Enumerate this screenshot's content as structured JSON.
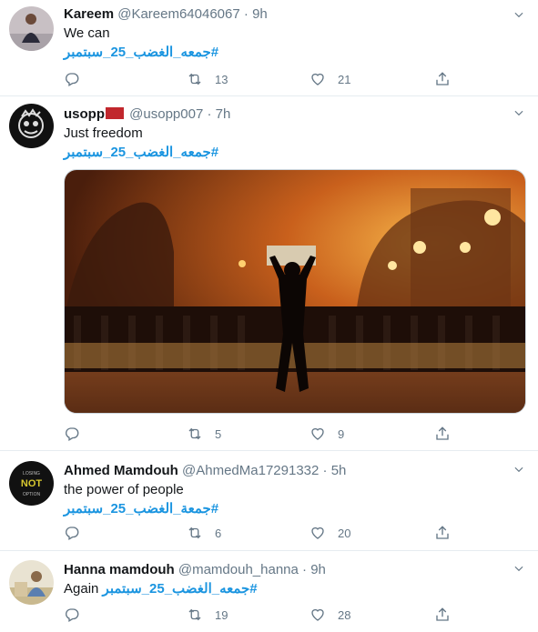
{
  "tweets": [
    {
      "name": "Kareem",
      "handle": "@Kareem64046067",
      "dot": "·",
      "time": "9h",
      "text": "We can",
      "hashtag": "#جمعه_الغضب_25_سبتمبر",
      "retweets": "13",
      "likes": "21"
    },
    {
      "name": "usopp",
      "handle": "@usopp007",
      "dot": "·",
      "time": "7h",
      "text": "Just freedom",
      "hashtag": "#جمعه_الغضب_25_سبتمبر",
      "retweets": "5",
      "likes": "9"
    },
    {
      "name": "Ahmed Mamdouh",
      "handle": "@AhmedMa17291332",
      "dot": "·",
      "time": "5h",
      "text": "the power of people",
      "hashtag": "#جمعة_الغضب_25_سبتمبر",
      "retweets": "6",
      "likes": "20",
      "avatar_text": [
        "LOSING",
        "NOT",
        "OPTION"
      ]
    },
    {
      "name": "Hanna mamdouh",
      "handle": "@mamdouh_hanna",
      "dot": "·",
      "time": "9h",
      "text": "Again",
      "hashtag": "#جمعه_الغضب_25_سبتمبر",
      "retweets": "19",
      "likes": "28"
    }
  ],
  "icons": {
    "reply": "reply-icon",
    "retweet": "retweet-icon",
    "like": "heart-icon",
    "share": "share-icon",
    "caret": "chevron-down-icon"
  },
  "colors": {
    "link": "#1b95e0",
    "secondary": "#657786",
    "border": "#e6ecf0"
  }
}
